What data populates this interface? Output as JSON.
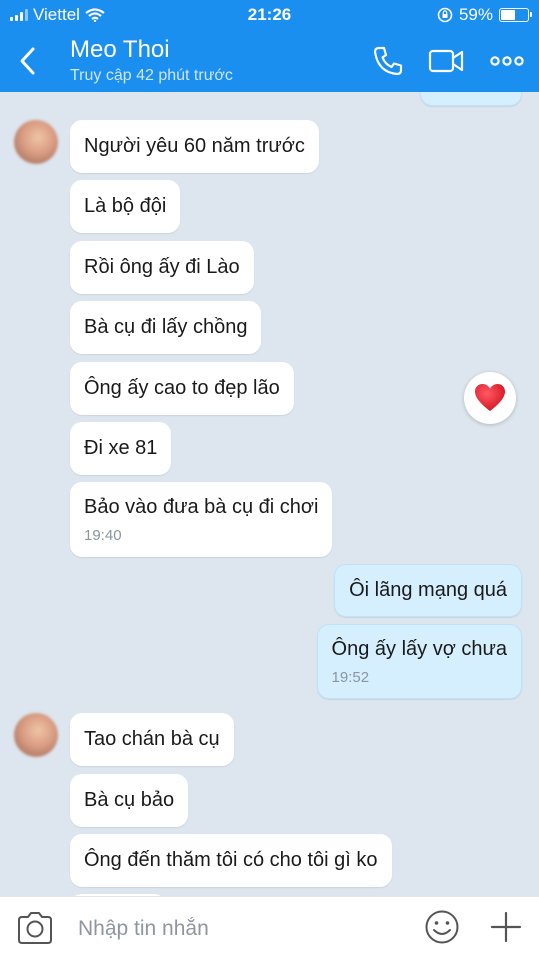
{
  "status_bar": {
    "carrier": "Viettel",
    "time": "21:26",
    "battery_text": "59%",
    "battery_level": 0.59
  },
  "header": {
    "contact_name": "Meo Thoi",
    "last_seen": "Truy cập 42 phút trước"
  },
  "messages": [
    {
      "text": "Người yêu 60 năm trước"
    },
    {
      "text": "Là bộ đội"
    },
    {
      "text": "Rồi ông ấy đi Lào"
    },
    {
      "text": "Bà cụ đi lấy chồng"
    },
    {
      "text": "Ông ấy cao to đẹp lão"
    },
    {
      "text": "Đi xe 81"
    },
    {
      "text": "Bảo vào đưa bà cụ đi chơi",
      "time": "19:40"
    },
    {
      "text": "Ôi lãng mạng quá"
    },
    {
      "text": "Ông ấy lấy vợ chưa",
      "time": "19:52"
    },
    {
      "text": "Tao chán bà cụ"
    },
    {
      "text": "Bà cụ bảo"
    },
    {
      "text": "Ông đến thăm tôi có cho tôi gì ko"
    }
  ],
  "composer": {
    "placeholder": "Nhập tin nhắn"
  },
  "colors": {
    "header_bg": "#1a8ff0",
    "chat_bg": "#dde5ee",
    "incoming_bubble": "#ffffff",
    "outgoing_bubble": "#d5efff",
    "heart": "#e3202f"
  },
  "icons": [
    "back-arrow-icon",
    "phone-icon",
    "video-camera-icon",
    "more-options-icon",
    "heart-icon",
    "camera-icon",
    "emoji-icon",
    "plus-icon"
  ]
}
